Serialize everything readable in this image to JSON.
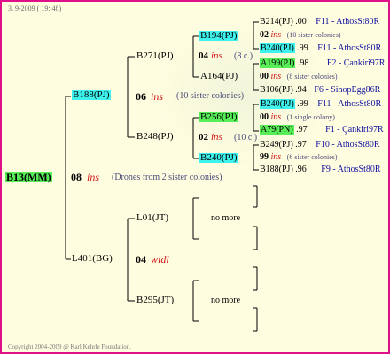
{
  "header": {
    "date": "3. 9-2009 ( 19: 48)"
  },
  "footer": {
    "copyright": "Copyright 2004-2009 @ Karl Kehrle Foundation."
  },
  "colors": {
    "frame": "#e0108a",
    "background": "#fffde0",
    "cyan": "#3ef2ee",
    "green": "#58ee58",
    "ins": "#d21414",
    "link": "#1010a0"
  },
  "root": {
    "id": "B13(MM)",
    "gen": "08",
    "mark": "ins",
    "note": "(Drones from 2 sister colonies)"
  },
  "upper": {
    "id": "B188(PJ)",
    "gen": "06",
    "mark": "ins",
    "note": "(10 sister colonies)"
  },
  "lower": {
    "id": "L401(BG)",
    "gen": "04",
    "mark": "widl"
  },
  "b271": {
    "id": "B271(PJ)"
  },
  "b248": {
    "id": "B248(PJ)"
  },
  "b194": {
    "id": "B194(PJ)",
    "gen": "04",
    "mark": "ins",
    "note": "(8 c.)"
  },
  "a164": {
    "id": "A164(PJ)"
  },
  "b256": {
    "id": "B256(PJ)",
    "gen": "02",
    "mark": "ins",
    "note": "(10 c.)"
  },
  "b240m": {
    "id": "B240(PJ)"
  },
  "l01": {
    "id": "L01(JT)",
    "note": "no more"
  },
  "b295": {
    "id": "B295(JT)",
    "note": "no more"
  },
  "leaves": [
    {
      "id": "B214(PJ)",
      "year": ".00",
      "code": "F11 - AthosSt80R"
    },
    {
      "gen": "02",
      "mark": "ins",
      "note": "(10 sister colonies)"
    },
    {
      "id": "B240(PJ)",
      "year": ".99",
      "code": "F11 - AthosSt80R"
    },
    {
      "id": "A199(PJ)",
      "year": ".98",
      "code": "F2 - Çankiri97R"
    },
    {
      "gen": "00",
      "mark": "ins",
      "note": "(8 sister colonies)"
    },
    {
      "id": "B106(PJ)",
      "year": ".94",
      "code": "F6 - SinopEgg86R"
    },
    {
      "id": "B240(PJ)",
      "year": ".99",
      "code": "F11 - AthosSt80R"
    },
    {
      "gen": "00",
      "mark": "ins",
      "note": "(1 single colony)"
    },
    {
      "id": "A79(PN)",
      "year": ".97",
      "code": "F1 - Çankiri97R"
    },
    {
      "id": "B249(PJ)",
      "year": ".97",
      "code": "F10 - AthosSt80R"
    },
    {
      "gen": "99",
      "mark": "ins",
      "note": "(6 sister colonies)"
    },
    {
      "id": "B188(PJ)",
      "year": ".96",
      "code": "F9 - AthosSt80R"
    }
  ]
}
